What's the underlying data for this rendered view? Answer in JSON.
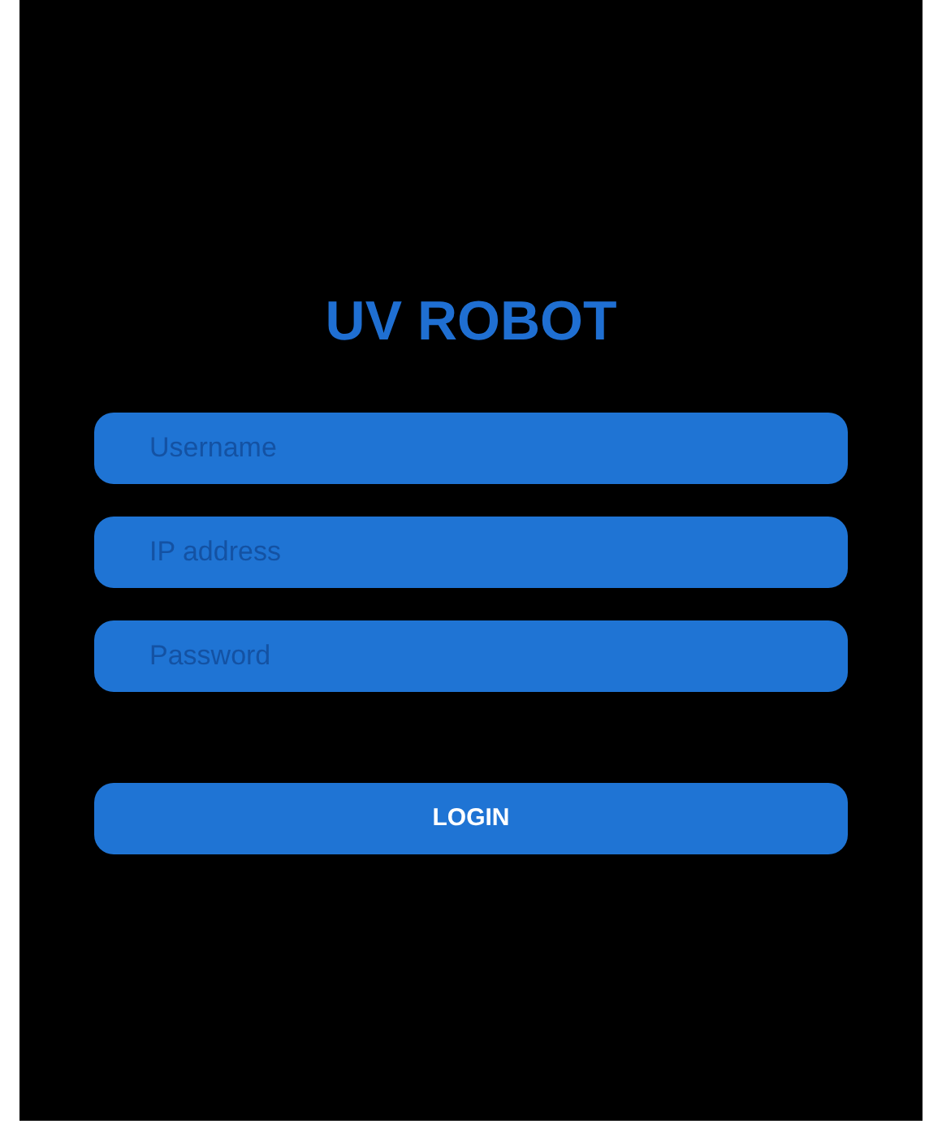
{
  "title": "UV ROBOT",
  "fields": [
    {
      "placeholder": "Username"
    },
    {
      "placeholder": "IP address"
    },
    {
      "placeholder": "Password"
    }
  ],
  "login_button": "LOGIN"
}
